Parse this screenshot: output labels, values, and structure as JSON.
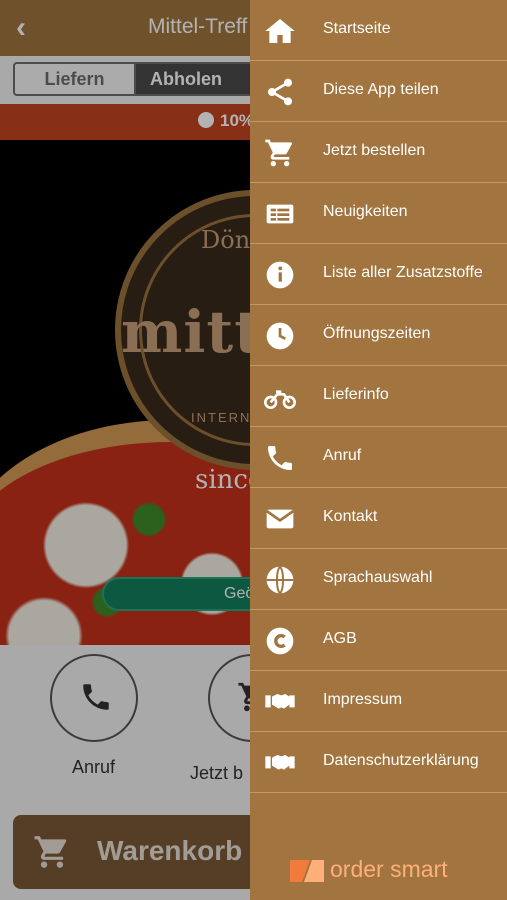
{
  "app": {
    "title": "Mittel-Treff",
    "segments": {
      "delivery": "Liefern",
      "pickup": "Abholen"
    },
    "promo": "10%",
    "logo": {
      "top": "Döner",
      "name": "mitte",
      "bottom": "INTERNATIO",
      "since": "since"
    },
    "open_status": "Geö",
    "actions": {
      "call": "Anruf",
      "order": "Jetzt b"
    },
    "cart": "Warenkorb"
  },
  "drawer": {
    "items": [
      {
        "label": "Startseite",
        "icon": "home-icon"
      },
      {
        "label": "Diese App teilen",
        "icon": "share-icon"
      },
      {
        "label": "Jetzt bestellen",
        "icon": "cart-icon"
      },
      {
        "label": "Neuigkeiten",
        "icon": "news-icon"
      },
      {
        "label": "Liste aller Zusatzstoffe",
        "icon": "info-icon"
      },
      {
        "label": "Öffnungszeiten",
        "icon": "clock-icon"
      },
      {
        "label": "Lieferinfo",
        "icon": "motorcycle-icon"
      },
      {
        "label": "Anruf",
        "icon": "phone-icon"
      },
      {
        "label": "Kontakt",
        "icon": "mail-icon"
      },
      {
        "label": "Sprachauswahl",
        "icon": "globe-icon"
      },
      {
        "label": "AGB",
        "icon": "copyright-icon"
      },
      {
        "label": "Impressum",
        "icon": "handshake-icon"
      },
      {
        "label": "Datenschutzerklärung",
        "icon": "handshake-icon"
      }
    ],
    "brand": "order smart"
  },
  "colors": {
    "drawer": "#a2743f",
    "topbar": "#a0763f",
    "promo": "#c2451f",
    "open_pill": "#137f5e",
    "brand": "#ffb07a"
  }
}
